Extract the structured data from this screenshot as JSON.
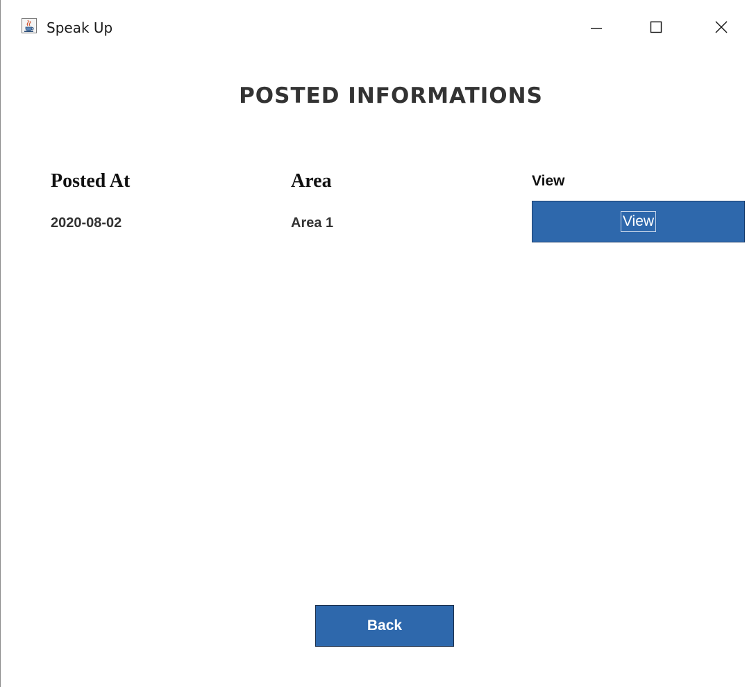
{
  "window": {
    "title": "Speak Up",
    "icon": "java-cup-icon",
    "controls": {
      "minimize_icon": "minimize-icon",
      "maximize_icon": "maximize-icon",
      "close_icon": "close-icon"
    }
  },
  "page": {
    "heading": "POSTED INFORMATIONS"
  },
  "table": {
    "headers": {
      "posted_at": "Posted At",
      "area": "Area",
      "view": "View"
    },
    "rows": [
      {
        "posted_at": "2020-08-02",
        "area": "Area 1",
        "view_label": "View"
      }
    ]
  },
  "footer": {
    "back_label": "Back"
  },
  "colors": {
    "button_blue": "#2e68ac",
    "text_dark": "#333333",
    "background": "#ffffff"
  }
}
